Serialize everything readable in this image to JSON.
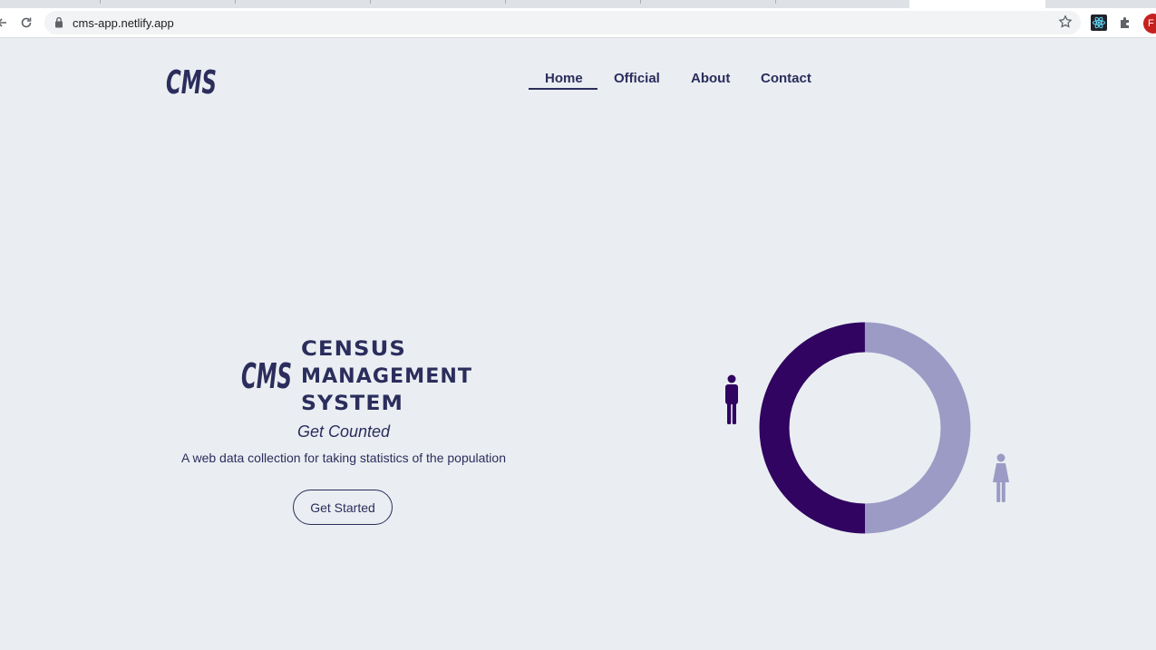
{
  "browser": {
    "url": "cms-app.netlify.app",
    "profile_initial": "F"
  },
  "header": {
    "logo_text": "CMS",
    "nav": [
      {
        "label": "Home",
        "active": true
      },
      {
        "label": "Official",
        "active": false
      },
      {
        "label": "About",
        "active": false
      },
      {
        "label": "Contact",
        "active": false
      }
    ]
  },
  "hero": {
    "logo_text": "CMS",
    "brand_lines": [
      "CENSUS",
      "MANAGEMENT",
      "SYSTEM"
    ],
    "tagline": "Get Counted",
    "subtitle": "A web data collection for taking statistics of the population",
    "cta_label": "Get Started"
  },
  "graphic": {
    "male_share": 0.5,
    "female_share": 0.5,
    "male_color": "#300460",
    "female_color": "#9b9bc5"
  },
  "colors": {
    "background": "#eaeef2",
    "text": "#2b2d5c"
  },
  "icons": [
    "reload-icon",
    "back-icon",
    "lock-icon",
    "star-icon",
    "react-devtools-icon",
    "extensions-icon",
    "male-icon",
    "female-icon"
  ]
}
